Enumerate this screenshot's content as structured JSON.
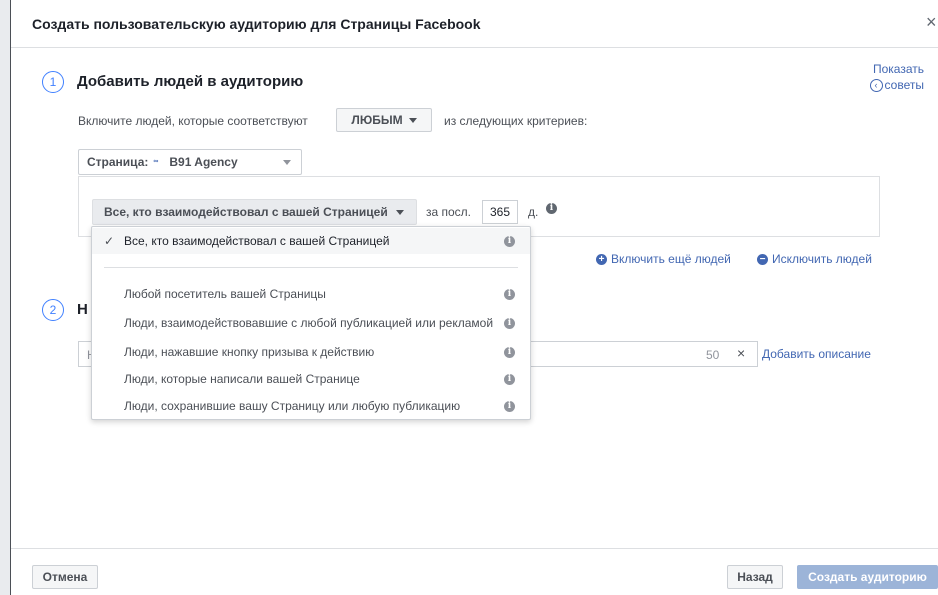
{
  "dialog": {
    "title": "Создать пользовательскую аудиторию для Страницы Facebook",
    "close": "×"
  },
  "tips": {
    "line1": "Показать",
    "line2": "советы"
  },
  "step1": {
    "number": "1",
    "title": "Добавить людей в аудиторию",
    "include_prefix": "Включите людей, которые соответствуют",
    "match_any_label": "ЛЮБЫМ",
    "include_suffix": "из следующих критериев:",
    "page_select": {
      "label": "Страница:",
      "page_name": "B91 Agency"
    },
    "engagement_selected": "Все, кто взаимодействовал с вашей Страницей",
    "in_last_label": "за посл.",
    "days_value": "365",
    "days_unit": "д."
  },
  "dropdown_options": [
    {
      "label": "Все, кто взаимодействовал с вашей Страницей",
      "selected": true
    },
    {
      "label": "Любой посетитель вашей Страницы",
      "selected": false
    },
    {
      "label": "Люди, взаимодействовавшие с любой публикацией или рекламой",
      "selected": false
    },
    {
      "label": "Люди, нажавшие кнопку призыва к действию",
      "selected": false
    },
    {
      "label": "Люди, которые написали вашей Странице",
      "selected": false
    },
    {
      "label": "Люди, сохранившие вашу Страницу или любую публикацию",
      "selected": false
    }
  ],
  "actions": {
    "include_more": "Включить ещё людей",
    "exclude": "Исключить людей"
  },
  "step2": {
    "number": "2",
    "title_visible": "Н",
    "input_visible": "Н",
    "char_counter": "50",
    "clear": "×",
    "add_description": "Добавить описание"
  },
  "footer": {
    "cancel": "Отмена",
    "back": "Назад",
    "create": "Создать аудиторию"
  },
  "colors": {
    "accent": "#4267b2",
    "step_circle": "#4080ff",
    "disabled_primary": "#9cb4d8"
  }
}
